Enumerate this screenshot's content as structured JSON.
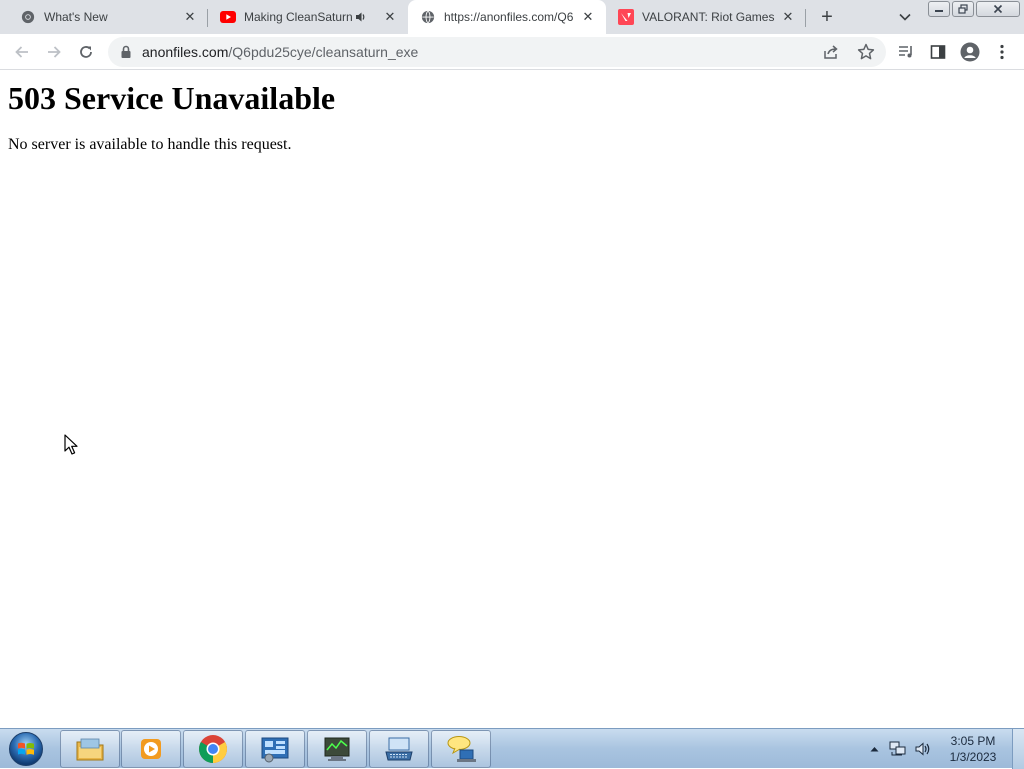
{
  "browser": {
    "tabs": [
      {
        "title": "What's New",
        "favicon": "chrome-icon",
        "active": false
      },
      {
        "title": "Making CleanSaturn",
        "favicon": "youtube-icon",
        "audio": true,
        "active": false
      },
      {
        "title": "https://anonfiles.com/Q6",
        "favicon": "globe-icon",
        "active": true
      },
      {
        "title": "VALORANT: Riot Games",
        "favicon": "valorant-icon",
        "active": false
      }
    ],
    "address": {
      "domain": "anonfiles.com",
      "path": "/Q6pdu25cye/cleansaturn_exe"
    }
  },
  "page": {
    "heading": "503 Service Unavailable",
    "message": "No server is available to handle this request."
  },
  "taskbar": {
    "apps": [
      "explorer-icon",
      "media-player-icon",
      "chrome-icon",
      "control-panel-icon",
      "task-manager-icon",
      "keyboard-icon",
      "network-chat-icon"
    ],
    "clock": {
      "time": "3:05 PM",
      "date": "1/3/2023"
    }
  },
  "colors": {
    "tabstrip": "#dee1e6",
    "omnibox": "#f1f3f4",
    "taskbar": "#a9c4e0",
    "youtube_red": "#ff0000",
    "valorant_red": "#ff4655"
  }
}
